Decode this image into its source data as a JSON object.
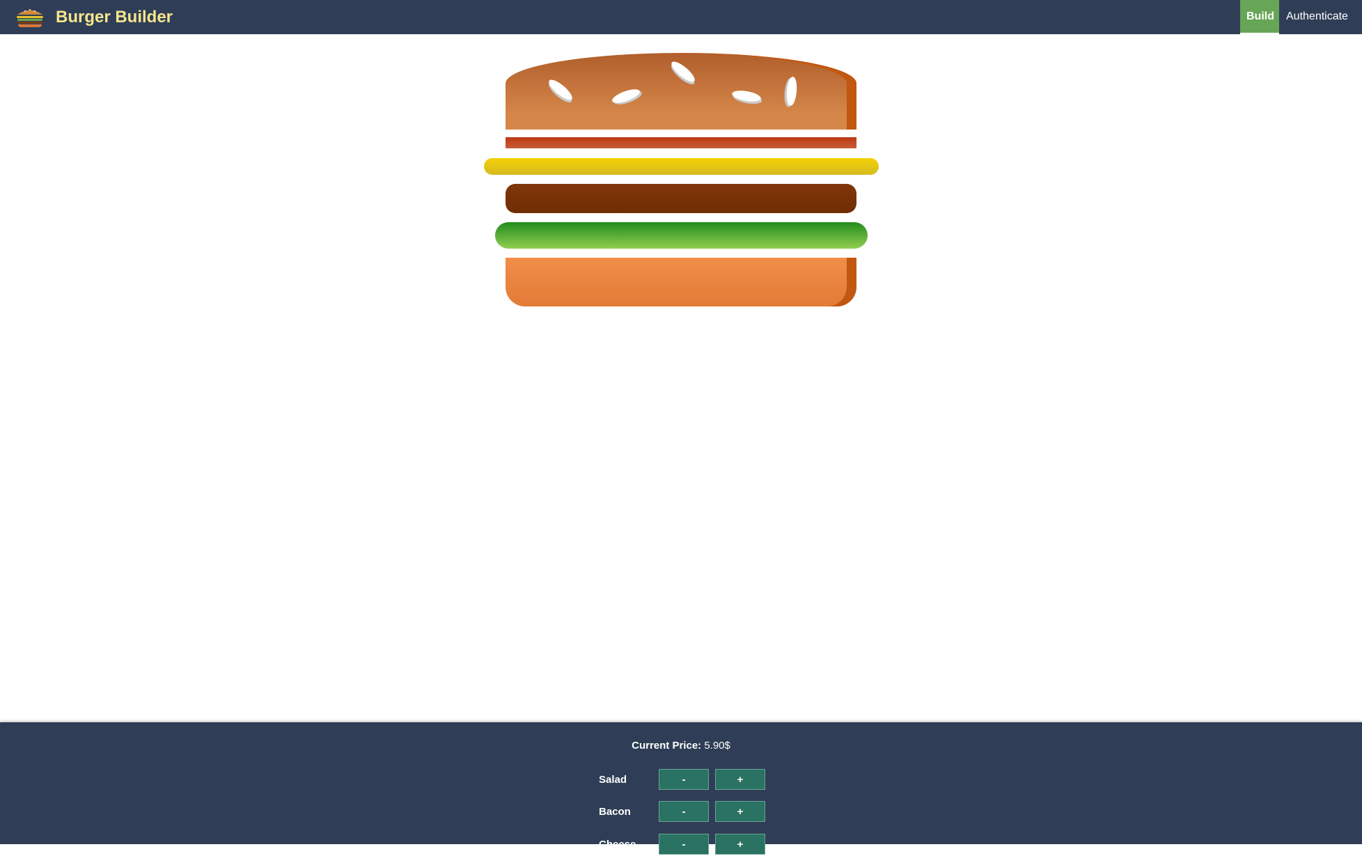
{
  "toolbar": {
    "logo_icon": "burger-logo-icon",
    "brand": "Burger Builder",
    "nav": [
      {
        "label": "Build",
        "active": true
      },
      {
        "label": "Authenticate",
        "active": false
      }
    ],
    "colors": {
      "background": "#2f3e56",
      "active": "#67a557",
      "brand_text": "#f6e58d"
    }
  },
  "burger": {
    "layers": [
      "bread-top",
      "bacon",
      "cheese",
      "meat",
      "salad",
      "bread-bottom"
    ]
  },
  "build_controls": {
    "price_label": "Current Price:",
    "price_value": "5.90$",
    "controls": [
      {
        "label": "Salad",
        "less": "-",
        "more": "+"
      },
      {
        "label": "Bacon",
        "less": "-",
        "more": "+"
      },
      {
        "label": "Cheese",
        "less": "-",
        "more": "+"
      }
    ],
    "colors": {
      "button": "#2a7262",
      "background": "#2f3e56"
    }
  }
}
